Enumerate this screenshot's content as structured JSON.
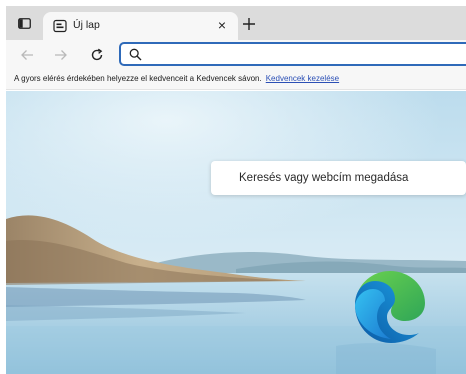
{
  "browser": {
    "tab": {
      "title": "Új lap",
      "close_symbol": "×",
      "favicon": "newtab-page-icon"
    },
    "new_tab_symbol": "+",
    "toolbar": {
      "back_icon": "back-arrow-icon",
      "forward_icon": "forward-arrow-icon",
      "refresh_icon": "refresh-icon",
      "address": {
        "value": "",
        "icon": "search-icon"
      }
    },
    "favorites_bar": {
      "message": "A gyors elérés érdekében helyezze el kedvenceit a Kedvencek sávon.",
      "link": "Kedvencek kezelése"
    }
  },
  "page": {
    "search_placeholder": "Keresés vagy webcím megadása",
    "logo": "edge-logo"
  },
  "colors": {
    "address_border": "#2f6ab9",
    "link": "#2b4fb5",
    "tabstrip": "#dcdcdc",
    "toolbar": "#f7f7f7",
    "sky": "#c9e2f0",
    "water": "#a9cde2"
  }
}
